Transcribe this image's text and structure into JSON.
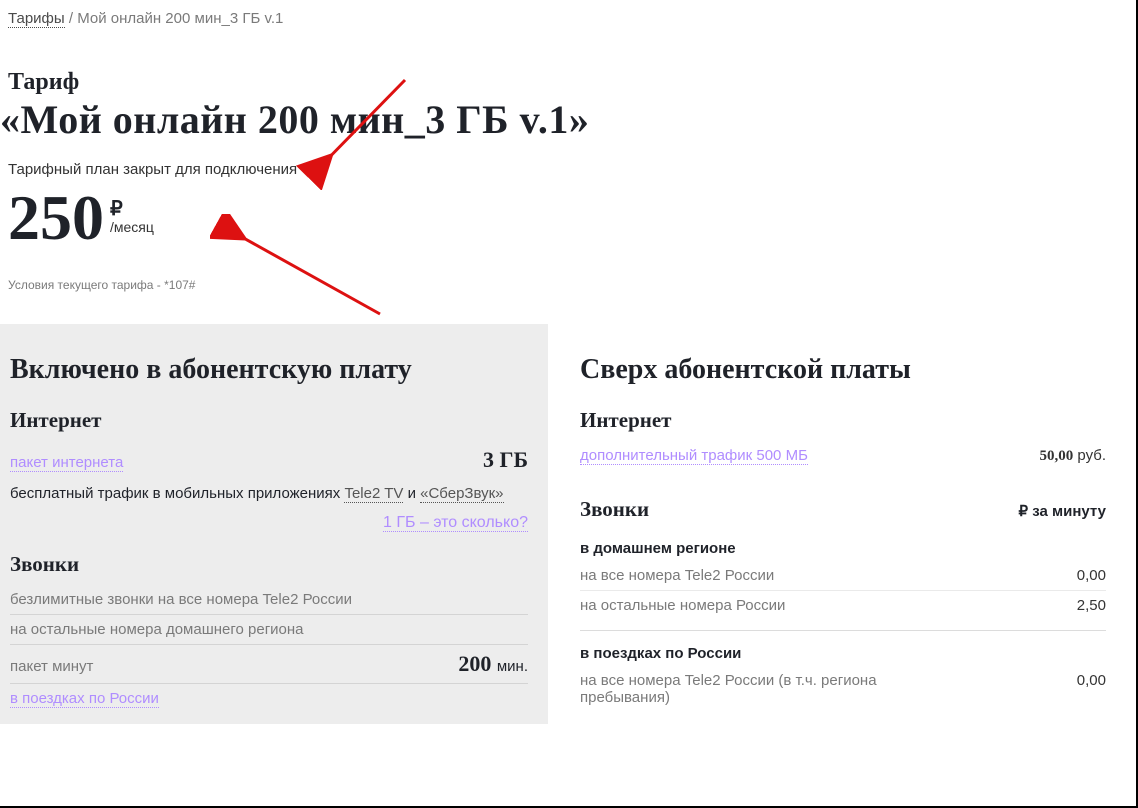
{
  "breadcrumb": {
    "root": "Тарифы",
    "current": "Мой онлайн 200 мин_3 ГБ v.1"
  },
  "header": {
    "superlabel": "Тариф",
    "title": "«Мой онлайн 200 мин_3 ГБ v.1»",
    "closed_note": "Тарифный план закрыт для подключения",
    "price_amount": "250",
    "price_currency": "₽",
    "price_period": "/месяц",
    "condition_note": "Условия текущего тарифа - *107#"
  },
  "included": {
    "title": "Включено в абонентскую плату",
    "internet": {
      "h": "Интернет",
      "package_link": "пакет интернета",
      "package_value": "3",
      "package_unit": "ГБ",
      "free_traffic_prefix": "бесплатный трафик в мобильных приложениях ",
      "app1": "Tele2 TV",
      "between": " и ",
      "app2": "«СберЗвук»",
      "gb_helper": "1 ГБ – это сколько?"
    },
    "calls": {
      "h": "Звонки",
      "unlimited": "безлимитные звонки на все номера Tele2 России",
      "other_home": "на остальные номера домашнего региона",
      "min_pack_label": "пакет минут",
      "min_pack_value": "200",
      "min_pack_unit": "мин.",
      "trips_link": "в поездках по России"
    }
  },
  "extra": {
    "title": "Сверх абонентской платы",
    "internet": {
      "h": "Интернет",
      "add_traffic_link": "дополнительный трафик 500 МБ",
      "add_traffic_price": "50,00",
      "add_traffic_unit": "руб."
    },
    "calls": {
      "h": "Звонки",
      "per_min_currency": "₽",
      "per_min_label": "за минуту",
      "home_sub": "в домашнем регионе",
      "home_tele2_label": "на все номера Tele2 России",
      "home_tele2_price": "0,00",
      "home_other_label": "на остальные номера России",
      "home_other_price": "2,50",
      "trips_sub": "в поездках по России",
      "trips_tele2_label": "на все номера Tele2 России (в т.ч. региона пребывания)",
      "trips_tele2_price": "0,00"
    }
  }
}
